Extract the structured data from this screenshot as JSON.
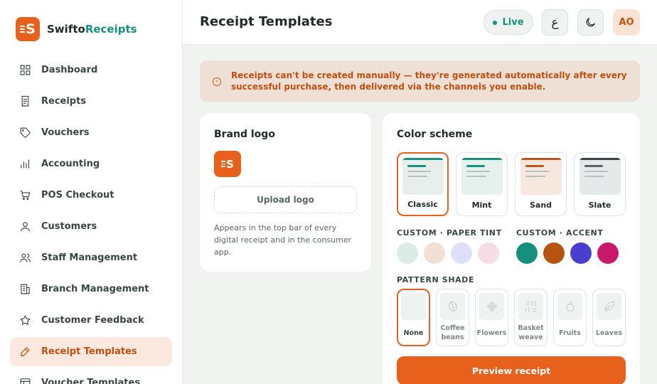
{
  "brand": {
    "name_prefix": "Swifto",
    "name_suffix": "Receipts",
    "logo_letter": "S",
    "color": "#e8611c"
  },
  "sidebar": {
    "items": [
      {
        "label": "Dashboard",
        "icon": "grid-icon",
        "active": false
      },
      {
        "label": "Receipts",
        "icon": "receipt-icon",
        "active": false
      },
      {
        "label": "Vouchers",
        "icon": "tag-icon",
        "active": false
      },
      {
        "label": "Accounting",
        "icon": "bar-chart-icon",
        "active": false
      },
      {
        "label": "POS Checkout",
        "icon": "cart-icon",
        "active": false
      },
      {
        "label": "Customers",
        "icon": "user-icon",
        "active": false
      },
      {
        "label": "Staff Management",
        "icon": "users-icon",
        "active": false
      },
      {
        "label": "Branch Management",
        "icon": "building-icon",
        "active": false
      },
      {
        "label": "Customer Feedback",
        "icon": "star-icon",
        "active": false
      },
      {
        "label": "Receipt Templates",
        "icon": "pen-icon",
        "active": true
      },
      {
        "label": "Voucher Templates",
        "icon": "template-icon",
        "active": false
      }
    ]
  },
  "header": {
    "title": "Receipt Templates",
    "live_label": "Live",
    "language_glyph": "ع",
    "theme_icon": "moon-icon",
    "avatar_initials": "AO"
  },
  "notice": {
    "icon": "alert-circle-icon",
    "text": "Receipts can't be created manually — they're generated automatically after every successful purchase, then delivered via the channels you enable."
  },
  "brand_logo_card": {
    "title": "Brand logo",
    "logo_letter": "S",
    "upload_label": "Upload logo",
    "help_text": "Appears in the top bar of every digital receipt and in the consumer app."
  },
  "color_card": {
    "title": "Color scheme",
    "schemes": [
      {
        "label": "Classic",
        "selected": true,
        "bg": "#e8eeec",
        "bar": "#17907f",
        "line": "#17907f"
      },
      {
        "label": "Mint",
        "selected": false,
        "bg": "#e6f1ee",
        "bar": "#17907f",
        "line": "#17907f"
      },
      {
        "label": "Sand",
        "selected": false,
        "bg": "#f7e8df",
        "bar": "#b9561a",
        "line": "#b9561a"
      },
      {
        "label": "Slate",
        "selected": false,
        "bg": "#e6e9e9",
        "bar": "#3a4448",
        "line": "#59636a"
      }
    ],
    "paper_tint_label": "CUSTOM · PAPER TINT",
    "paper_tints": [
      "#dcebe7",
      "#f3e0d4",
      "#dde0f7",
      "#f6dce4"
    ],
    "accent_label": "CUSTOM · ACCENT",
    "accents": [
      "#15907f",
      "#b4540f",
      "#4a3ed1",
      "#c8196b"
    ],
    "pattern_label": "PATTERN SHADE",
    "patterns": [
      {
        "label": "None",
        "selected": true,
        "icon": "none"
      },
      {
        "label": "Coffee beans",
        "selected": false,
        "icon": "coffee-bean-icon"
      },
      {
        "label": "Flowers",
        "selected": false,
        "icon": "flower-icon"
      },
      {
        "label": "Basket weave",
        "selected": false,
        "icon": "basket-weave-icon"
      },
      {
        "label": "Fruits",
        "selected": false,
        "icon": "fruit-icon"
      },
      {
        "label": "Leaves",
        "selected": false,
        "icon": "leaf-icon"
      }
    ],
    "preview_label": "Preview receipt"
  }
}
